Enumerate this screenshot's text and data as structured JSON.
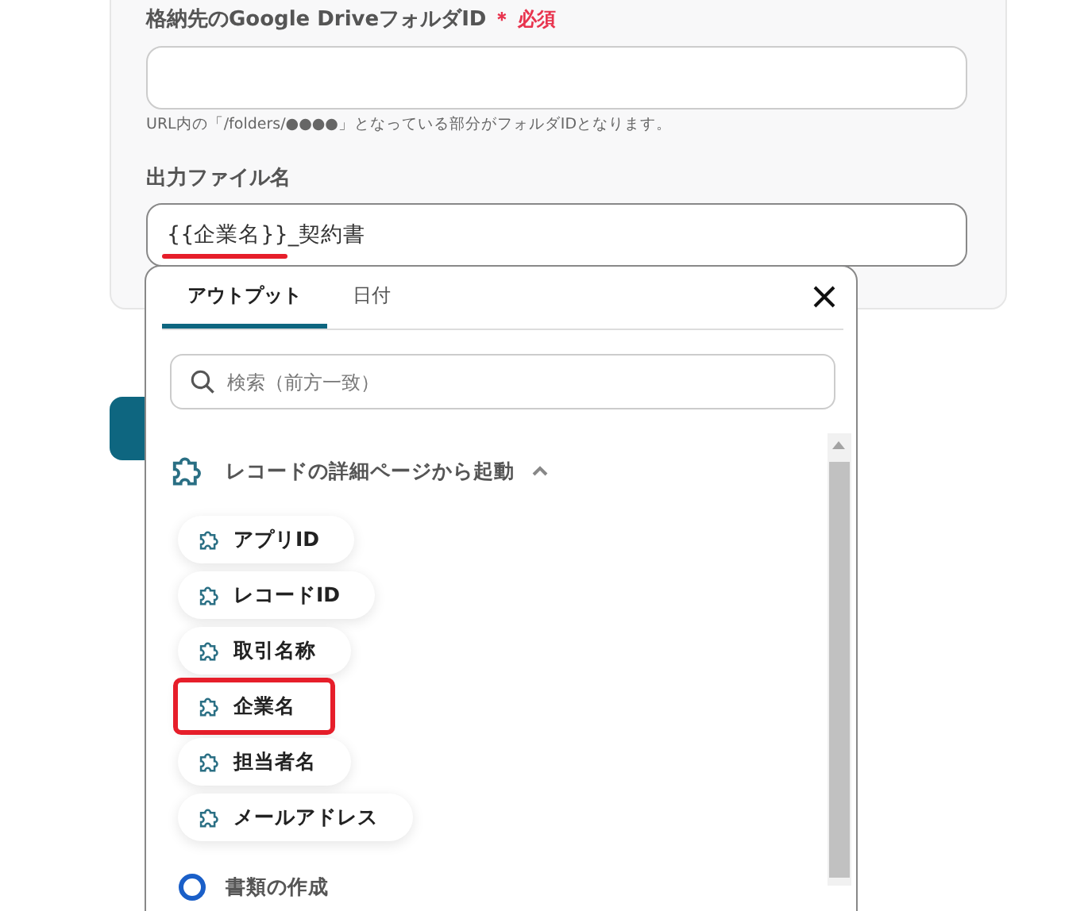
{
  "form": {
    "folder_field": {
      "label": "格納先のGoogle DriveフォルダID",
      "required_mark": "＊",
      "required_label": "必須",
      "hint": "URL内の「/folders/●●●●」となっている部分がフォルダIDとなります。"
    },
    "filename_field": {
      "label": "出力ファイル名",
      "token": "{{企業名}}",
      "token_underlined": true,
      "value_rest": "_契約書"
    }
  },
  "popup": {
    "tabs": [
      {
        "label": "アウトプット",
        "selected": true
      },
      {
        "label": "日付",
        "selected": false
      }
    ],
    "search": {
      "placeholder": "検索（前方一致）"
    },
    "groups": [
      {
        "title": "レコードの詳細ページから起動",
        "expanded": true,
        "items": [
          {
            "label": "アプリID",
            "highlighted": false
          },
          {
            "label": "レコードID",
            "highlighted": false
          },
          {
            "label": "取引名称",
            "highlighted": false
          },
          {
            "label": "企業名",
            "highlighted": true
          },
          {
            "label": "担当者名",
            "highlighted": false
          },
          {
            "label": "メールアドレス",
            "highlighted": false
          }
        ]
      },
      {
        "title": "書類の作成",
        "expanded": false
      }
    ]
  }
}
